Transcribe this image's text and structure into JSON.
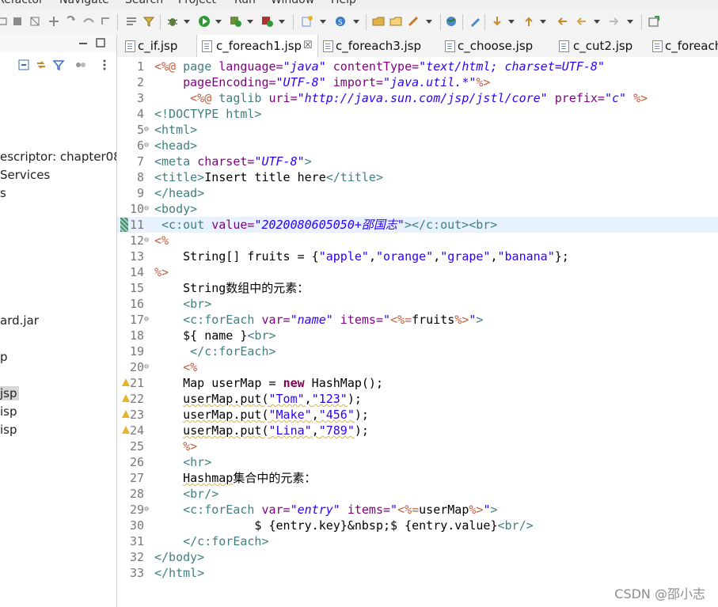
{
  "menu": [
    "Refactor",
    "Navigate",
    "Search",
    "Project",
    "Run",
    "Window",
    "Help"
  ],
  "left_panel": {
    "items": [
      {
        "label": "escriptor: chapter08"
      },
      {
        "label": "Services"
      },
      {
        "label": "s"
      },
      {
        "label": "ard.jar"
      },
      {
        "label": "p"
      },
      {
        "label": "jsp",
        "selected": true
      },
      {
        "label": "isp"
      },
      {
        "label": "isp"
      }
    ]
  },
  "tabs": [
    {
      "label": "c_if.jsp"
    },
    {
      "label": "c_foreach1.jsp",
      "active": true,
      "close": "☒"
    },
    {
      "label": "c_foreach3.jsp"
    },
    {
      "label": "c_choose.jsp"
    },
    {
      "label": "c_cut2.jsp"
    },
    {
      "label": "c_foreach"
    }
  ],
  "editor": {
    "current_line": 11,
    "lines": [
      {
        "n": "1"
      },
      {
        "n": "2"
      },
      {
        "n": "3"
      },
      {
        "n": "4"
      },
      {
        "n": "5",
        "fold": "⊖"
      },
      {
        "n": "6",
        "fold": "⊖"
      },
      {
        "n": "7"
      },
      {
        "n": "8"
      },
      {
        "n": "9"
      },
      {
        "n": "10",
        "fold": "⊖"
      },
      {
        "n": "11"
      },
      {
        "n": "12",
        "fold": "⊖"
      },
      {
        "n": "13"
      },
      {
        "n": "14"
      },
      {
        "n": "15"
      },
      {
        "n": "16"
      },
      {
        "n": "17",
        "fold": "⊖"
      },
      {
        "n": "18"
      },
      {
        "n": "19"
      },
      {
        "n": "20",
        "fold": "⊖"
      },
      {
        "n": "21",
        "warn": true
      },
      {
        "n": "22",
        "warn": true
      },
      {
        "n": "23",
        "warn": true
      },
      {
        "n": "24",
        "warn": true
      },
      {
        "n": "25"
      },
      {
        "n": "26"
      },
      {
        "n": "27"
      },
      {
        "n": "28"
      },
      {
        "n": "29",
        "fold": "⊖"
      },
      {
        "n": "30"
      },
      {
        "n": "31"
      },
      {
        "n": "32"
      },
      {
        "n": "33"
      }
    ],
    "code": {
      "l1_a": "<%@ ",
      "l1_b": "page ",
      "l1_c": "language=",
      "l1_d": "\"java\"",
      "l1_e": " contentType=",
      "l1_f": "\"text/html; charset=UTF-8\"",
      "l2_a": "    pageEncoding=",
      "l2_b": "\"UTF-8\"",
      "l2_c": " import=",
      "l2_d": "\"java.util.*\"",
      "l2_e": "%>",
      "l3_a": "     <%@ ",
      "l3_b": "taglib ",
      "l3_c": "uri=",
      "l3_d": "\"http://java.sun.com/jsp/jstl/core\"",
      "l3_e": " prefix=",
      "l3_f": "\"c\"",
      "l3_g": " %>",
      "l4": "<!DOCTYPE html>",
      "l5": "<html>",
      "l6": "<head>",
      "l7_a": "<meta ",
      "l7_b": "charset=",
      "l7_c": "\"UTF-8\"",
      "l7_d": ">",
      "l8_a": "<title>",
      "l8_b": "Insert title here",
      "l8_c": "</title>",
      "l9": "</head>",
      "l10": "<body>",
      "l11_a": " <c:out ",
      "l11_b": "value=",
      "l11_c": "\"2020080605050+邵国志\"",
      "l11_d": "></c:out><br>",
      "l12": "<%",
      "l13_a": "    String[] fruits = {",
      "l13_b": "\"apple\"",
      "l13_c": ",",
      "l13_d": "\"orange\"",
      "l13_e": ",",
      "l13_f": "\"grape\"",
      "l13_g": ",",
      "l13_h": "\"banana\"",
      "l13_i": "};",
      "l14": "%>",
      "l15": "    String数组中的元素：",
      "l16": "    <br>",
      "l17_a": "    <c:forEach ",
      "l17_b": "var=",
      "l17_c": "\"name\"",
      "l17_d": " items=",
      "l17_e": "\"",
      "l17_f": "<%=",
      "l17_g": "fruits",
      "l17_h": "%>",
      "l17_i": "\"",
      "l17_j": ">",
      "l18_a": "    ${ name }",
      "l18_b": "<br>",
      "l19": "     </c:forEach>",
      "l20": "    <%",
      "l21_a": "    Map userMap = ",
      "l21_b": "new",
      "l21_c": " HashMap();",
      "l22_a": "    ",
      "l22_b": "userMap.put",
      "l22_c": "(",
      "l22_d": "\"Tom\"",
      "l22_e": ",",
      "l22_f": "\"123\"",
      "l22_g": ");",
      "l23_a": "    ",
      "l23_b": "userMap.put",
      "l23_c": "(",
      "l23_d": "\"Make\"",
      "l23_e": ",",
      "l23_f": "\"456\"",
      "l23_g": ");",
      "l24_a": "    ",
      "l24_b": "userMap.put",
      "l24_c": "(",
      "l24_d": "\"Lina\"",
      "l24_e": ",",
      "l24_f": "\"789\"",
      "l24_g": ");",
      "l25": "    %>",
      "l26": "    <hr>",
      "l27_a": "    ",
      "l27_b": "Hashmap",
      "l27_c": "集合中的元素：",
      "l28": "    <br/>",
      "l29_a": "    <c:forEach ",
      "l29_b": "var=",
      "l29_c": "\"entry\"",
      "l29_d": " items=",
      "l29_e": "\"",
      "l29_f": "<%=",
      "l29_g": "userMap",
      "l29_h": "%>",
      "l29_i": "\"",
      "l29_j": ">",
      "l30_a": "              $ {entry.key}&nbsp;$ {entry.value}",
      "l30_b": "<br/>",
      "l31": "    </c:forEach>",
      "l32": "</body>",
      "l33": "</html>"
    }
  },
  "watermark": "CSDN @邵小志",
  "colors": {
    "keyword": "#7f0055",
    "tag": "#3f7f7f",
    "attr": "#7f007f",
    "value": "#2a00ff",
    "directive": "#bf5f3f",
    "current_line": "#e8f2fe",
    "warning": "#e6b32b"
  }
}
